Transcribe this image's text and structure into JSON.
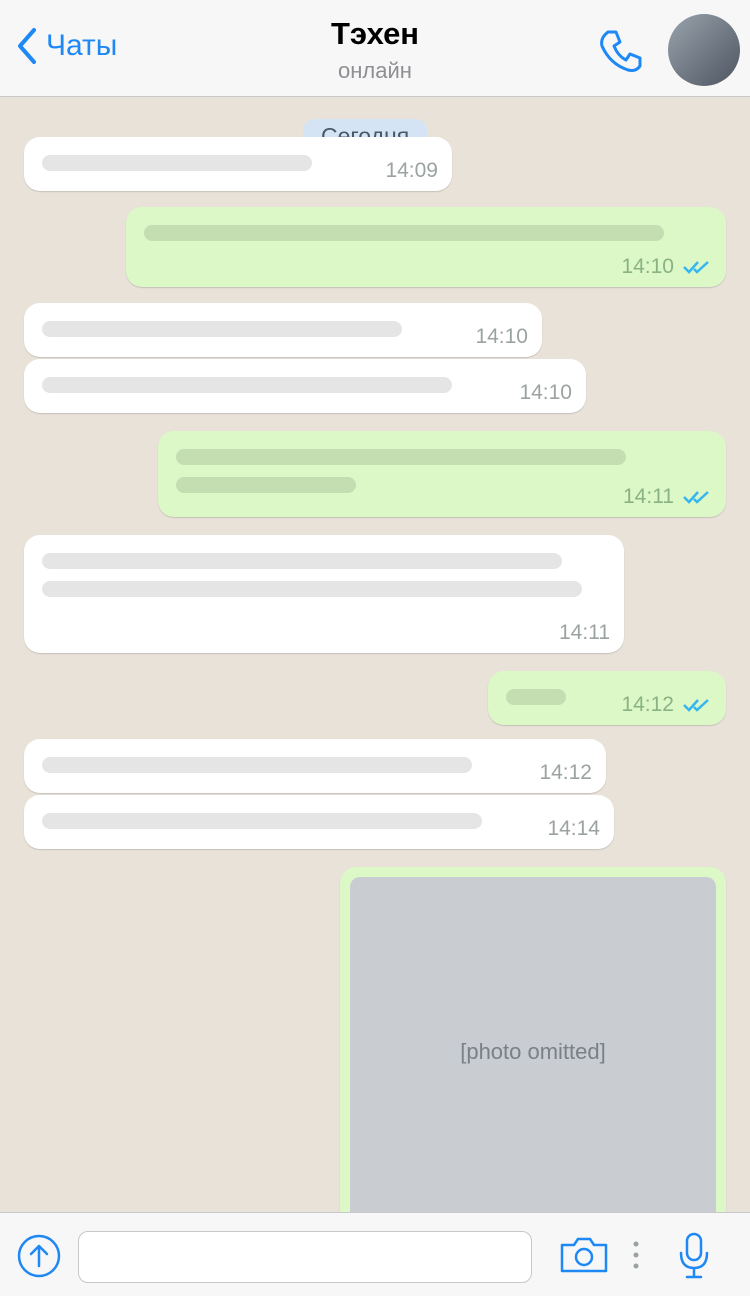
{
  "header": {
    "back_label": "Чаты",
    "contact_name": "Тэхен",
    "status": "онлайн"
  },
  "chat": {
    "day_label": "Сегодня",
    "messages": [
      {
        "time": "14:09"
      },
      {
        "time": "14:10"
      },
      {
        "time": "14:10"
      },
      {
        "time": "14:10"
      },
      {
        "time": "14:11"
      },
      {
        "time": "14:11"
      },
      {
        "time": "14:12"
      },
      {
        "time": "14:12"
      },
      {
        "time": "14:14"
      }
    ],
    "photo_placeholder": "[photo omitted]"
  },
  "colors": {
    "accent": "#1e88f5",
    "incoming": "#ffffff",
    "outgoing": "#dcf8c6",
    "background": "#e8e2d9"
  },
  "icons": [
    "chevron-left-icon",
    "phone-icon",
    "upload-icon",
    "camera-icon",
    "more-icon",
    "microphone-icon",
    "double-check-icon"
  ]
}
